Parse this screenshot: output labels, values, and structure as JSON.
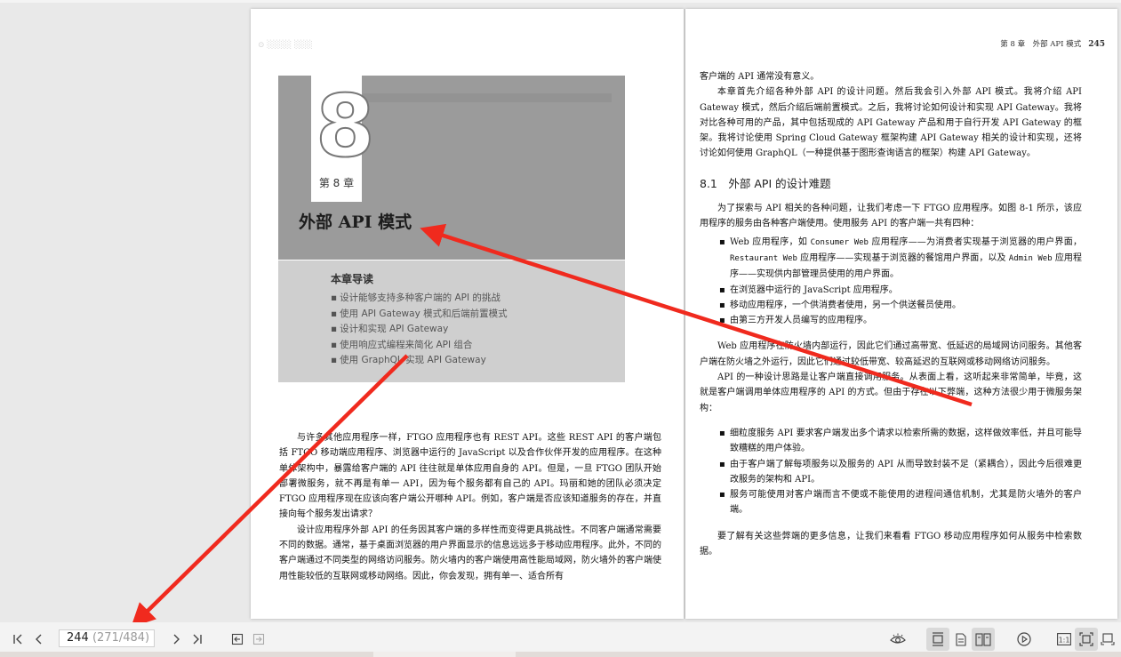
{
  "left_page": {
    "chapter_number": "8",
    "chapter_label": "第 8 章",
    "chapter_title": "外部 API 模式",
    "intro_title": "本章导读",
    "intro_items": [
      "设计能够支持多种客户端的 API 的挑战",
      "使用 API Gateway 模式和后端前置模式",
      "设计和实现 API Gateway",
      "使用响应式编程来简化 API 组合",
      "使用 GraphQL 实现 API Gateway"
    ],
    "paragraphs": [
      "与许多其他应用程序一样，FTGO 应用程序也有 REST API。这些 REST API 的客户端包括 FTGO 移动端应用程序、浏览器中运行的 JavaScript 以及合作伙伴开发的应用程序。在这种单体架构中，暴露给客户端的 API 往往就是单体应用自身的 API。但是，一旦 FTGO 团队开始部署微服务，就不再是有单一 API，因为每个服务都有自己的 API。玛丽和她的团队必须决定 FTGO 应用程序现在应该向客户端公开哪种 API。例如，客户端是否应该知道服务的存在，并直接向每个服务发出请求？",
      "设计应用程序外部 API 的任务因其客户端的多样性而变得更具挑战性。不同客户端通常需要不同的数据。通常，基于桌面浏览器的用户界面显示的信息远远多于移动应用程序。此外，不同的客户端通过不同类型的网络访问服务。防火墙内的客户端使用高性能局域网，防火墙外的客户端使用性能较低的互联网或移动网络。因此，你会发现，拥有单一、适合所有"
    ]
  },
  "right_page": {
    "running_head": "第 8 章　外部 API 模式",
    "page_number": "245",
    "para_top": "客户端的 API 通常没有意义。",
    "para_intro": "本章首先介绍各种外部 API 的设计问题。然后我会引入外部 API 模式。我将介绍 API Gateway 模式，然后介绍后端前置模式。之后，我将讨论如何设计和实现 API Gateway。我将对比各种可用的产品，其中包括现成的 API Gateway 产品和用于自行开发 API Gateway 的框架。我将讨论使用 Spring Cloud Gateway 框架构建 API Gateway 相关的设计和实现，还将讨论如何使用 GraphQL（一种提供基于图形查询语言的框架）构建 API Gateway。",
    "section_heading": "8.1　外部 API 的设计难题",
    "para_section": "为了探索与 API 相关的各种问题，让我们考虑一下 FTGO 应用程序。如图 8-1 所示，该应用程序的服务由各种客户端使用。使用服务 API 的客户端一共有四种：",
    "b1_pre": "Web 应用程序，如 ",
    "b1_mono1": "Consumer Web",
    "b1_mid": " 应用程序——为消费者实现基于浏览器的用户界面，",
    "b1_mono2": "Restaurant Web",
    "b1_mid2": " 应用程序——实现基于浏览器的餐馆用户界面，以及 ",
    "b1_mono3": "Admin Web",
    "b1_post": " 应用程序——实现供内部管理员使用的用户界面。",
    "b2": "在浏览器中运行的 JavaScript 应用程序。",
    "b3": "移动应用程序，一个供消费者使用，另一个供送餐员使用。",
    "b4": "由第三方开发人员编写的应用程序。",
    "para_web": "Web 应用程序在防火墙内部运行，因此它们通过高带宽、低延迟的局域网访问服务。其他客户端在防火墙之外运行，因此它们通过较低带宽、较高延迟的互联网或移动网络访问服务。",
    "para_api": "API 的一种设计思路是让客户端直接调用服务。从表面上看，这听起来非常简单，毕竟，这就是客户端调用单体应用程序的 API 的方式。但由于存在以下弊端，这种方法很少用于微服务架构：",
    "drawbacks": [
      "细粒度服务 API 要求客户端发出多个请求以检索所需的数据，这样做效率低，并且可能导致糟糕的用户体验。",
      "由于客户端了解每项服务以及服务的 API 从而导致封装不足（紧耦合），因此今后很难更改服务的架构和 API。",
      "服务可能使用对客户端而言不便或不能使用的进程间通信机制，尤其是防火墙外的客户端。"
    ],
    "para_end": "要了解有关这些弊端的更多信息，让我们来看看 FTGO 移动应用程序如何从服务中检索数据。"
  },
  "toolbar": {
    "current_page": "244",
    "page_total": " (271/484)",
    "active_view": "two-page",
    "active_fit": "fit-page",
    "icons": {
      "first": "first-page-icon",
      "prev": "prev-page-icon",
      "next": "next-page-icon",
      "last": "last-page-icon",
      "back": "back-icon",
      "forward": "forward-icon",
      "eye": "eye-icon",
      "scroll": "scroll-mode-icon",
      "single": "single-page-icon",
      "double": "two-page-icon",
      "play": "play-icon",
      "actual": "actual-size-icon",
      "fitpage": "fit-page-icon",
      "fitwidth": "fit-width-icon"
    }
  },
  "colors": {
    "annotation_arrow": "#f02a1e",
    "background": "#e9e9e9",
    "toolbar": "#f3f3f3"
  }
}
